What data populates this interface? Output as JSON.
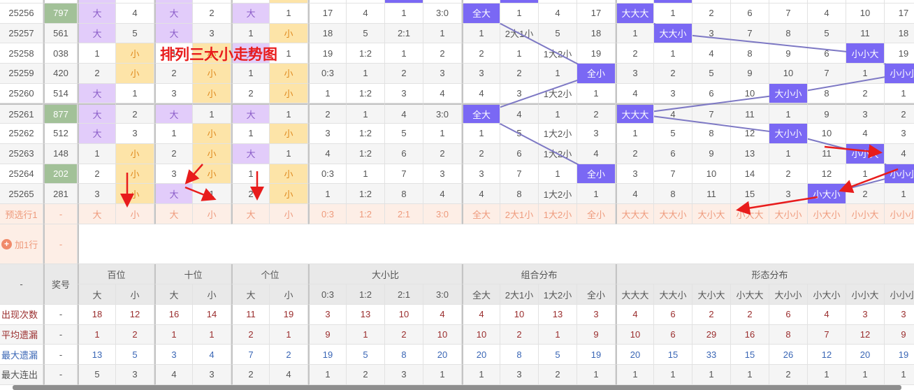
{
  "title_overlay": "排列三大小走势图",
  "colors": {
    "big_bg": "#e2ccfa",
    "small_bg": "#fde4a8",
    "hit_bg": "#7a68f4",
    "number_highlight": "#a2c198",
    "trend_line": "#7d78c4",
    "annotation_arrow": "#e81c1c"
  },
  "columns": [
    "大",
    "小",
    "大",
    "小",
    "大",
    "小",
    "0:3",
    "1:2",
    "2:1",
    "3:0",
    "全大",
    "2大1小",
    "1大2小",
    "全小",
    "大大大",
    "大大小",
    "大小大",
    "小大大",
    "大小小",
    "小大小",
    "小小大",
    "小小小"
  ],
  "groups": [
    "百位",
    "十位",
    "个位",
    "大小比",
    "组合分布",
    "形态分布"
  ],
  "rows": [
    {
      "issue": "25256",
      "number": "797",
      "highlight": true,
      "cells": [
        "大",
        "4",
        "大",
        "2",
        "大",
        "1",
        "17",
        "4",
        "1",
        "3:0",
        "全大",
        "1",
        "4",
        "17",
        "大大大",
        "1",
        "2",
        "6",
        "7",
        "4",
        "10",
        "17"
      ]
    },
    {
      "issue": "25257",
      "number": "561",
      "highlight": false,
      "cells": [
        "大",
        "5",
        "大",
        "3",
        "1",
        "小",
        "18",
        "5",
        "2:1",
        "1",
        "1",
        "2大1小",
        "5",
        "18",
        "1",
        "大大小",
        "3",
        "7",
        "8",
        "5",
        "11",
        "18"
      ]
    },
    {
      "issue": "25258",
      "number": "038",
      "highlight": false,
      "cells": [
        "1",
        "小",
        "1",
        "小",
        "大",
        "1",
        "19",
        "1:2",
        "1",
        "2",
        "2",
        "1",
        "1大2小",
        "19",
        "2",
        "1",
        "4",
        "8",
        "9",
        "6",
        "小小大",
        "19"
      ]
    },
    {
      "issue": "25259",
      "number": "420",
      "highlight": false,
      "cells": [
        "2",
        "小",
        "2",
        "小",
        "1",
        "小",
        "0:3",
        "1",
        "2",
        "3",
        "3",
        "2",
        "1",
        "全小",
        "3",
        "2",
        "5",
        "9",
        "10",
        "7",
        "1",
        "小小小"
      ]
    },
    {
      "issue": "25260",
      "number": "514",
      "highlight": false,
      "cells": [
        "大",
        "1",
        "3",
        "小",
        "2",
        "小",
        "1",
        "1:2",
        "3",
        "4",
        "4",
        "3",
        "1大2小",
        "1",
        "4",
        "3",
        "6",
        "10",
        "大小小",
        "8",
        "2",
        "1"
      ]
    },
    {
      "issue": "25261",
      "number": "877",
      "highlight": true,
      "cells": [
        "大",
        "2",
        "大",
        "1",
        "大",
        "1",
        "2",
        "1",
        "4",
        "3:0",
        "全大",
        "4",
        "1",
        "2",
        "大大大",
        "4",
        "7",
        "11",
        "1",
        "9",
        "3",
        "2"
      ]
    },
    {
      "issue": "25262",
      "number": "512",
      "highlight": false,
      "cells": [
        "大",
        "3",
        "1",
        "小",
        "1",
        "小",
        "3",
        "1:2",
        "5",
        "1",
        "1",
        "5",
        "1大2小",
        "3",
        "1",
        "5",
        "8",
        "12",
        "大小小",
        "10",
        "4",
        "3"
      ]
    },
    {
      "issue": "25263",
      "number": "148",
      "highlight": false,
      "cells": [
        "1",
        "小",
        "2",
        "小",
        "大",
        "1",
        "4",
        "1:2",
        "6",
        "2",
        "2",
        "6",
        "1大2小",
        "4",
        "2",
        "6",
        "9",
        "13",
        "1",
        "11",
        "小小大",
        "4"
      ]
    },
    {
      "issue": "25264",
      "number": "202",
      "highlight": true,
      "cells": [
        "2",
        "小",
        "3",
        "小",
        "1",
        "小",
        "0:3",
        "1",
        "7",
        "3",
        "3",
        "7",
        "1",
        "全小",
        "3",
        "7",
        "10",
        "14",
        "2",
        "12",
        "1",
        "小小小"
      ]
    },
    {
      "issue": "25265",
      "number": "281",
      "highlight": false,
      "cells": [
        "3",
        "小",
        "大",
        "1",
        "2",
        "小",
        "1",
        "1:2",
        "8",
        "4",
        "4",
        "8",
        "1大2小",
        "1",
        "4",
        "8",
        "11",
        "15",
        "3",
        "小大小",
        "2",
        "1"
      ]
    }
  ],
  "preselect": {
    "label": "预选行1",
    "number": "-"
  },
  "add_row": {
    "label": "加1行",
    "number": "-"
  },
  "header": {
    "corner": "-",
    "number_label": "奖号"
  },
  "stats": [
    {
      "label": "出现次数",
      "number": "-",
      "style": "red",
      "values": [
        "18",
        "12",
        "16",
        "14",
        "11",
        "19",
        "3",
        "13",
        "10",
        "4",
        "4",
        "10",
        "13",
        "3",
        "4",
        "6",
        "2",
        "2",
        "6",
        "4",
        "3",
        "3"
      ]
    },
    {
      "label": "平均遗漏",
      "number": "-",
      "style": "red",
      "values": [
        "1",
        "2",
        "1",
        "1",
        "2",
        "1",
        "9",
        "1",
        "2",
        "10",
        "10",
        "2",
        "1",
        "9",
        "10",
        "6",
        "29",
        "16",
        "8",
        "7",
        "12",
        "9"
      ]
    },
    {
      "label": "最大遗漏",
      "number": "-",
      "style": "blue",
      "values": [
        "13",
        "5",
        "3",
        "4",
        "7",
        "2",
        "19",
        "5",
        "8",
        "20",
        "20",
        "8",
        "5",
        "19",
        "20",
        "15",
        "33",
        "15",
        "26",
        "12",
        "20",
        "19"
      ]
    },
    {
      "label": "最大连出",
      "number": "-",
      "style": "gray",
      "values": [
        "5",
        "3",
        "4",
        "3",
        "2",
        "4",
        "1",
        "2",
        "3",
        "1",
        "1",
        "3",
        "2",
        "1",
        "1",
        "1",
        "1",
        "1",
        "2",
        "1",
        "1",
        "1"
      ]
    }
  ]
}
